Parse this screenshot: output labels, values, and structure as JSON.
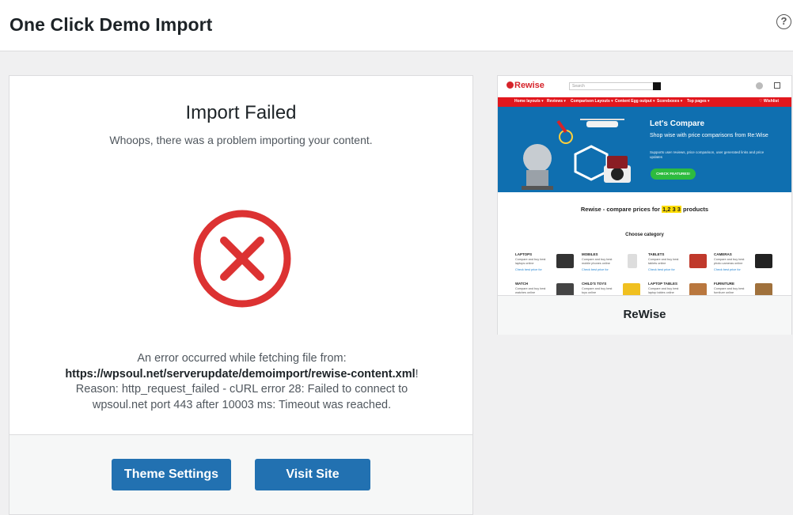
{
  "header": {
    "title": "One Click Demo Import",
    "help_icon": "question-circle-icon",
    "help_glyph": "?"
  },
  "result": {
    "title": "Import Failed",
    "subtitle": "Whoops, there was a problem importing your content.",
    "error_icon": "error-x-circle-icon",
    "error_color": "#dc3232",
    "message_prefix": "An error occurred while fetching file from:",
    "url": "https://wpsoul.net/serverupdate/demoimport/rewise-content.xml",
    "url_suffix": "!",
    "reason_line1": "Reason: http_request_failed - cURL error 28: Failed to connect to",
    "reason_line2": "wpsoul.net port 443 after 10003 ms: Timeout was reached."
  },
  "actions": {
    "theme_settings": "Theme Settings",
    "visit_site": "Visit Site",
    "button_color": "#2271b1"
  },
  "demo": {
    "name": "ReWise",
    "preview": {
      "logo": "Rewise",
      "search_placeholder": "Search",
      "nav": [
        "Home layouts ▾",
        "Reviews ▾",
        "Comparison Layouts ▾",
        "Content Egg output ▾",
        "Scoreboxes ▾",
        "Top pages ▾",
        "♡ Wishlist"
      ],
      "hero_title": "Let's Compare",
      "hero_sub": "Shop wise with price comparisons from Re:Wise",
      "hero_small": "Supports user reviews, price comparison, user generated links and price updates",
      "hero_button": "CHECK FEATURES!",
      "compare_prefix": "Rewise - compare prices for ",
      "compare_count": "1,2 3 3",
      "compare_suffix": " products",
      "category_title": "Choose category",
      "categories": [
        {
          "name": "LAPTOPS",
          "desc": "Compare and buy best laptops online",
          "link": "Check best price for"
        },
        {
          "name": "MOBILES",
          "desc": "Compare and buy best mobile phones online",
          "link": "Check best price for"
        },
        {
          "name": "TABLETS",
          "desc": "Compare and buy best tablets online",
          "link": "Check best price for"
        },
        {
          "name": "CAMERAS",
          "desc": "Compare and buy best photo cameras online",
          "link": "Check best price for"
        },
        {
          "name": "WATCH",
          "desc": "Compare and buy best watches online",
          "link": "Check best price for"
        },
        {
          "name": "CHILD'S TOYS",
          "desc": "Compare and buy best toys online",
          "link": "Check best price for"
        },
        {
          "name": "LAPTOP TABLES",
          "desc": "Compare and buy best laptop tables online",
          "link": "Check best price for"
        },
        {
          "name": "FURNITURE",
          "desc": "Compare and buy best furniture online",
          "link": "Check best price for"
        }
      ]
    }
  }
}
